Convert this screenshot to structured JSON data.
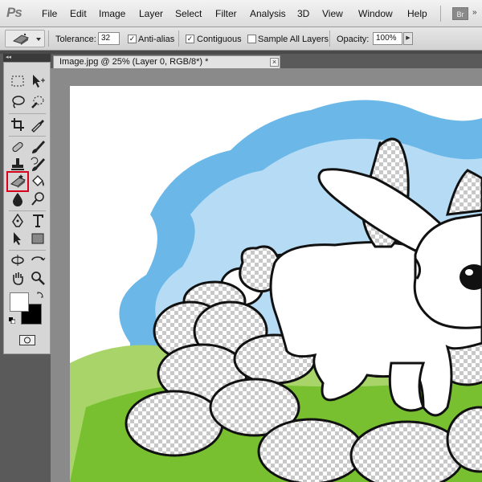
{
  "app": {
    "logo_text": "Ps",
    "bridge_label": "Br"
  },
  "menu": {
    "items": [
      "File",
      "Edit",
      "Image",
      "Layer",
      "Select",
      "Filter",
      "Analysis",
      "3D",
      "View",
      "Window",
      "Help"
    ]
  },
  "options_bar": {
    "tolerance_label": "Tolerance:",
    "tolerance_value": "32",
    "antialias_label": "Anti-alias",
    "antialias_checked": true,
    "contiguous_label": "Contiguous",
    "contiguous_checked": true,
    "sample_all_layers_label": "Sample All Layers",
    "sample_all_layers_checked": false,
    "opacity_label": "Opacity:",
    "opacity_value": "100%"
  },
  "document": {
    "tab_title": "Image.jpg @ 25% (Layer 0, RGB/8*) *",
    "close_symbol": "×"
  },
  "toolbox": {
    "selected_tool": "magic-eraser-tool",
    "colors": {
      "foreground": "#ffffff",
      "background": "#000000"
    }
  },
  "canvas_colors": {
    "sky_dark": "#6bb8e8",
    "sky_light": "#b6dcf5",
    "grass_light": "#a8d46a",
    "grass_dark": "#78c030",
    "outline": "#111111"
  }
}
